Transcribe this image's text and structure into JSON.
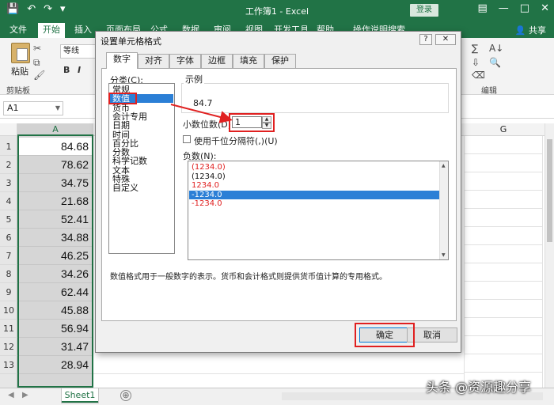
{
  "app": {
    "title": "工作簿1 - Excel",
    "login_label": "登录",
    "share_label": "共享"
  },
  "ribbon_tabs": [
    {
      "label": "文件",
      "active": false
    },
    {
      "label": "开始",
      "active": true
    },
    {
      "label": "插入",
      "active": false
    },
    {
      "label": "页面布局",
      "active": false
    },
    {
      "label": "公式",
      "active": false
    },
    {
      "label": "数据",
      "active": false
    },
    {
      "label": "审阅",
      "active": false
    },
    {
      "label": "视图",
      "active": false
    },
    {
      "label": "开发工具",
      "active": false
    },
    {
      "label": "帮助",
      "active": false
    },
    {
      "label": "操作说明搜索",
      "active": false
    }
  ],
  "ribbon": {
    "paste_label": "粘贴",
    "clipboard_group": "剪贴板",
    "font_name": "等线",
    "bold": "B",
    "italic": "I",
    "editing_group": "编辑"
  },
  "formula_bar": {
    "name_box": "A1"
  },
  "grid": {
    "col_a": "A",
    "col_g": "G",
    "rows": [
      {
        "n": "1",
        "a": "84.68"
      },
      {
        "n": "2",
        "a": "78.62"
      },
      {
        "n": "3",
        "a": "34.75"
      },
      {
        "n": "4",
        "a": "21.68"
      },
      {
        "n": "5",
        "a": "52.41"
      },
      {
        "n": "6",
        "a": "34.88"
      },
      {
        "n": "7",
        "a": "46.25"
      },
      {
        "n": "8",
        "a": "34.26"
      },
      {
        "n": "9",
        "a": "62.44"
      },
      {
        "n": "10",
        "a": "45.88"
      },
      {
        "n": "11",
        "a": "56.94"
      },
      {
        "n": "12",
        "a": "31.47"
      },
      {
        "n": "13",
        "a": "28.94"
      }
    ]
  },
  "sheet": {
    "tab": "Sheet1",
    "add": "⊕"
  },
  "dialog": {
    "title": "设置单元格格式",
    "help": "?",
    "close": "✕",
    "tabs": [
      "数字",
      "对齐",
      "字体",
      "边框",
      "填充",
      "保护"
    ],
    "category_label": "分类(C):",
    "categories": [
      "常规",
      "数值",
      "货币",
      "会计专用",
      "日期",
      "时间",
      "百分比",
      "分数",
      "科学记数",
      "文本",
      "特殊",
      "自定义"
    ],
    "selected_category": "数值",
    "sample_label": "示例",
    "sample_value": "84.7",
    "decimal_label": "小数位数(D):",
    "decimal_value": "1",
    "thousand_sep_label": "使用千位分隔符(,)(U)",
    "negative_label": "负数(N):",
    "negative_options": [
      {
        "text": "(1234.0)",
        "color": "#e02020",
        "selected": false
      },
      {
        "text": "(1234.0)",
        "color": "#111111",
        "selected": false
      },
      {
        "text": "1234.0",
        "color": "#e02020",
        "selected": false
      },
      {
        "text": "-1234.0",
        "color": "#ffffff",
        "selected": true
      },
      {
        "text": "-1234.0",
        "color": "#e02020",
        "selected": false
      }
    ],
    "description": "数值格式用于一般数字的表示。货币和会计格式则提供货币值计算的专用格式。",
    "ok_label": "确定",
    "cancel_label": "取消"
  },
  "colors": {
    "excel_green": "#217346",
    "highlight_red": "#e02020",
    "selection_blue": "#2b7fd6"
  },
  "watermark": "头条 @资源趣分享"
}
